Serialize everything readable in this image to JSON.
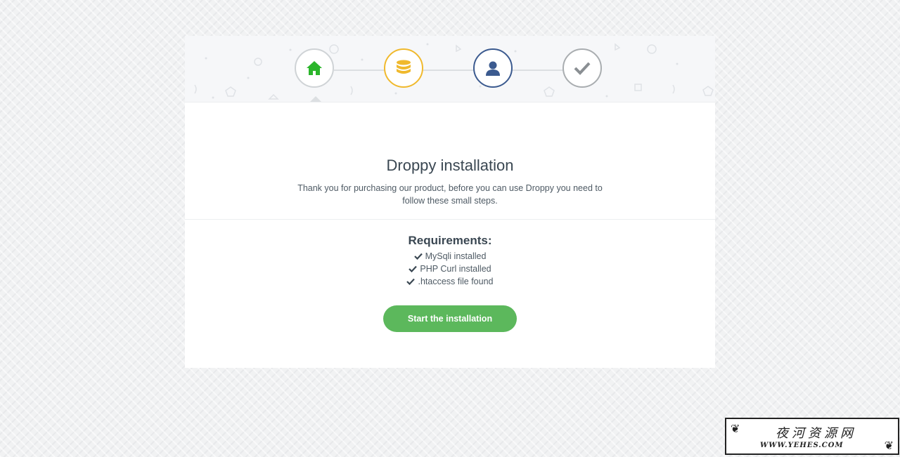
{
  "steps": [
    {
      "name": "home",
      "icon": "home-icon",
      "color": "#2bb52b",
      "border": "#cfd3d6"
    },
    {
      "name": "database",
      "icon": "database-icon",
      "color": "#f0b92d",
      "border": "#f0b92d"
    },
    {
      "name": "user",
      "icon": "user-icon",
      "color": "#3b5a8f",
      "border": "#3b5a8f"
    },
    {
      "name": "finish",
      "icon": "check-icon",
      "color": "#8a8f93",
      "border": "#a9adb0"
    }
  ],
  "main": {
    "title": "Droppy installation",
    "description": "Thank you for purchasing our product, before you can use Droppy you need to follow these small steps."
  },
  "requirements": {
    "title": "Requirements:",
    "items": [
      "MySqli installed",
      "PHP Curl installed",
      ".htaccess file found"
    ],
    "check_color": "#3a4752"
  },
  "button": {
    "label": "Start the installation",
    "color": "#5cb85c"
  },
  "watermark": {
    "chinese": "夜河资源网",
    "url": "WWW.YEHES.COM"
  }
}
